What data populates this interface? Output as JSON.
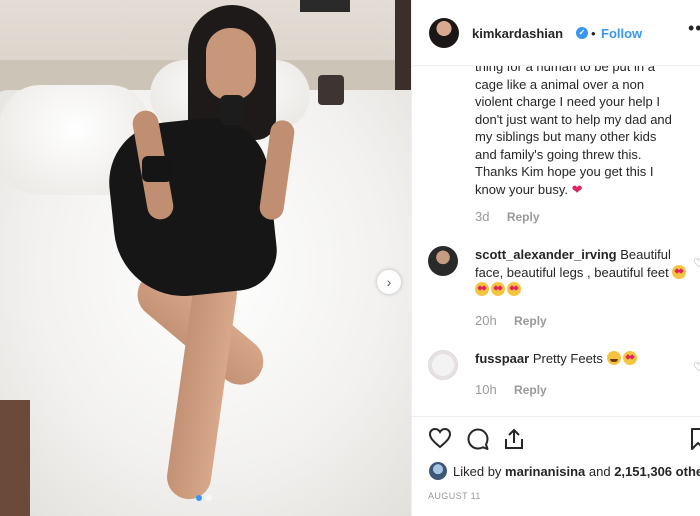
{
  "post": {
    "username": "kimkardashian",
    "verified_mark": "✓",
    "separator": "•",
    "follow_label": "Follow",
    "more_icon": "•••"
  },
  "comments": [
    {
      "user": "",
      "text_partial_line": "thing for a human to be put in a",
      "text_lines": [
        "cage like a animal over a non",
        "violent charge I need your help I",
        "don't just want to help my dad and",
        "my siblings but many other kids",
        "and family's going threw this.",
        "Thanks Kim hope you get this I",
        "know your busy."
      ],
      "emoji": "heart",
      "time": "3d",
      "reply_label": "Reply"
    },
    {
      "user": "scott_alexander_irving",
      "text": "Beautiful face, beautiful legs , beautiful feet",
      "emojis": [
        "heart-eyes",
        "heart-eyes",
        "heart-eyes",
        "heart-eyes"
      ],
      "time": "20h",
      "reply_label": "Reply"
    },
    {
      "user": "fusspaar",
      "text": "Pretty Feets",
      "emojis": [
        "grin",
        "heart-eyes"
      ],
      "time": "10h",
      "reply_label": "Reply"
    }
  ],
  "actions": {
    "icons": [
      "heart-icon",
      "comment-icon",
      "share-icon",
      "bookmark-icon"
    ]
  },
  "likes": {
    "prefix": "Liked by",
    "user": "marinanisina",
    "middle": "and",
    "count": "2,151,306",
    "suffix": "others"
  },
  "date": "AUGUST 11",
  "colors": {
    "link_blue": "#3897f0",
    "text": "#262626",
    "muted": "#999999",
    "border": "#efefef"
  }
}
